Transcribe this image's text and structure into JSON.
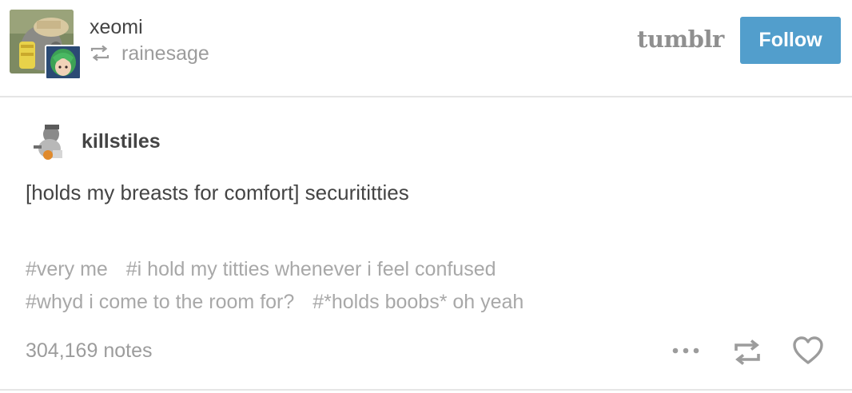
{
  "header": {
    "username": "xeomi",
    "reblogged_from": "rainesage",
    "logo_text": "tumblr",
    "follow_label": "Follow"
  },
  "post": {
    "op_username": "killstiles",
    "text": "[holds my breasts for comfort] securititties",
    "tags": [
      "#very me",
      "#i hold my titties whenever i feel confused",
      "#whyd i come to the room for?",
      "#*holds boobs* oh yeah"
    ]
  },
  "footer": {
    "notes": "304,169 notes"
  },
  "colors": {
    "follow_button": "#529ecc",
    "text": "#444444",
    "muted": "#9c9c9c",
    "tags": "#a8a8a8",
    "divider": "#e5e5e5"
  },
  "icons": [
    "reblog-icon",
    "more-icon",
    "heart-icon"
  ]
}
